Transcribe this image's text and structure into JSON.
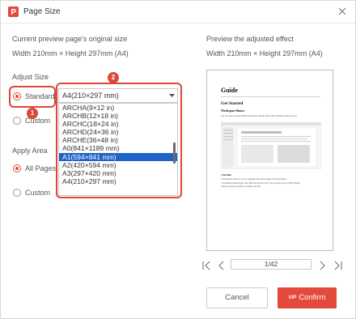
{
  "window": {
    "title": "Page Size"
  },
  "left": {
    "original_heading": "Current preview page's original size",
    "original_value": "Width 210mm × Height 297mm (A4)",
    "adjust_size_label": "Adjust Size",
    "standard_label": "Standard",
    "custom_label": "Custom",
    "apply_area_label": "Apply Area",
    "all_pages_label": "All Pages",
    "custom_area_label": "Custom",
    "select_value": "A4(210×297 mm)",
    "dropdown_options": [
      "ARCHA(9×12 in)",
      "ARCHB(12×18 in)",
      "ARCHC(18×24 in)",
      "ARCHD(24×36 in)",
      "ARCHE(36×48 in)",
      "A0(841×1189 mm)",
      "A1(594×841 mm)",
      "A2(420×594 mm)",
      "A3(297×420 mm)",
      "A4(210×297 mm)"
    ],
    "selected_option_index": 6
  },
  "annotations": {
    "badge_1": "1",
    "badge_2": "2"
  },
  "right": {
    "preview_heading": "Preview the adjusted effect",
    "preview_value": "Width 210mm × Height 297mm (A4)",
    "preview_doc": {
      "title": "Guide",
      "subtitle": "Get Started",
      "section": "Workspace Basics",
      "intro": "You can create yourself within the interface with the help of the Workspace Basics section.",
      "item_file_menu": "• File Menu",
      "item_file_desc": "Click the File button to access commands that can be applied to the document.",
      "item_file_list": "• File Menu includes Open, New PDF, Recent File, Save, Save as, Print, Export PDF, Settings,",
      "item_file_list2": "Check for updates, Feedback, Submit, and Exit."
    },
    "pager": {
      "first": "|<",
      "prev": "<",
      "page_text": "1/42",
      "next": ">",
      "last": ">|"
    }
  },
  "buttons": {
    "cancel": "Cancel",
    "confirm": "Confirm",
    "confirm_tag": "VIP"
  },
  "colors": {
    "accent": "#e34a3b",
    "selection": "#1f63c6"
  }
}
